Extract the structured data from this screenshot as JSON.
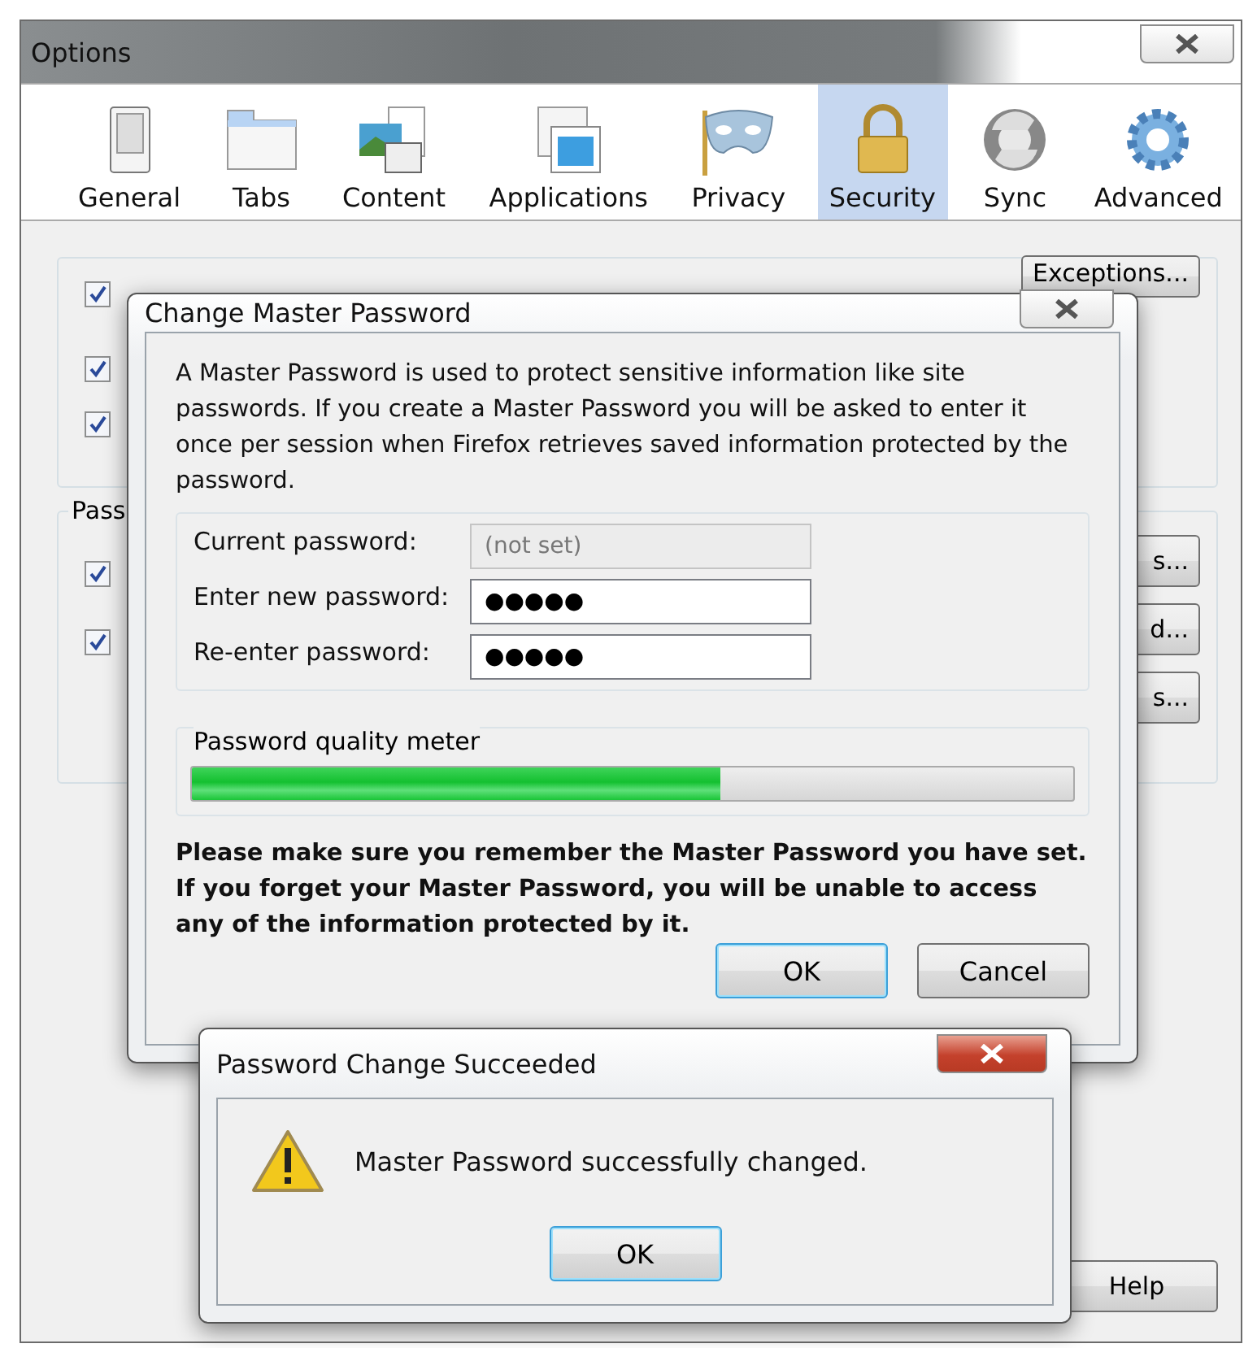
{
  "options_window": {
    "title": "Options",
    "toolbar": [
      {
        "label": "General",
        "selected": false
      },
      {
        "label": "Tabs",
        "selected": false
      },
      {
        "label": "Content",
        "selected": false
      },
      {
        "label": "Applications",
        "selected": false
      },
      {
        "label": "Privacy",
        "selected": false
      },
      {
        "label": "Security",
        "selected": true
      },
      {
        "label": "Sync",
        "selected": false
      },
      {
        "label": "Advanced",
        "selected": false
      }
    ],
    "addons_group": {
      "checkboxes": [
        {
          "checked": true
        },
        {
          "checked": true
        },
        {
          "checked": true
        }
      ],
      "button": "Exceptions..."
    },
    "passwords_group": {
      "label": "Pass",
      "checkboxes": [
        {
          "checked": true
        },
        {
          "checked": true
        }
      ],
      "buttons": [
        "s...",
        "d...",
        "s..."
      ]
    },
    "help_button": "Help"
  },
  "master_password_dialog": {
    "title": "Change Master Password",
    "description": "A Master Password is used to protect sensitive information like site passwords. If you create a Master Password you will be asked to enter it once per session when Firefox retrieves saved information protected by the password.",
    "fields": [
      {
        "label": "Current password:",
        "placeholder": "(not set)",
        "disabled": true
      },
      {
        "label": "Enter new password:",
        "value": "●●●●●",
        "disabled": false
      },
      {
        "label": "Re-enter password:",
        "value": "●●●●●",
        "disabled": false
      }
    ],
    "meter": {
      "label": "Password quality meter",
      "level": 0.6
    },
    "warning": "Please make sure you remember the Master Password you have set. If you forget your Master Password, you will be unable to access any of the information protected by it.",
    "buttons": [
      {
        "label": "OK",
        "default": true
      },
      {
        "label": "Cancel",
        "default": false
      }
    ]
  },
  "success_dialog": {
    "title": "Password Change Succeeded",
    "message": "Master Password successfully changed.",
    "button": "OK"
  }
}
